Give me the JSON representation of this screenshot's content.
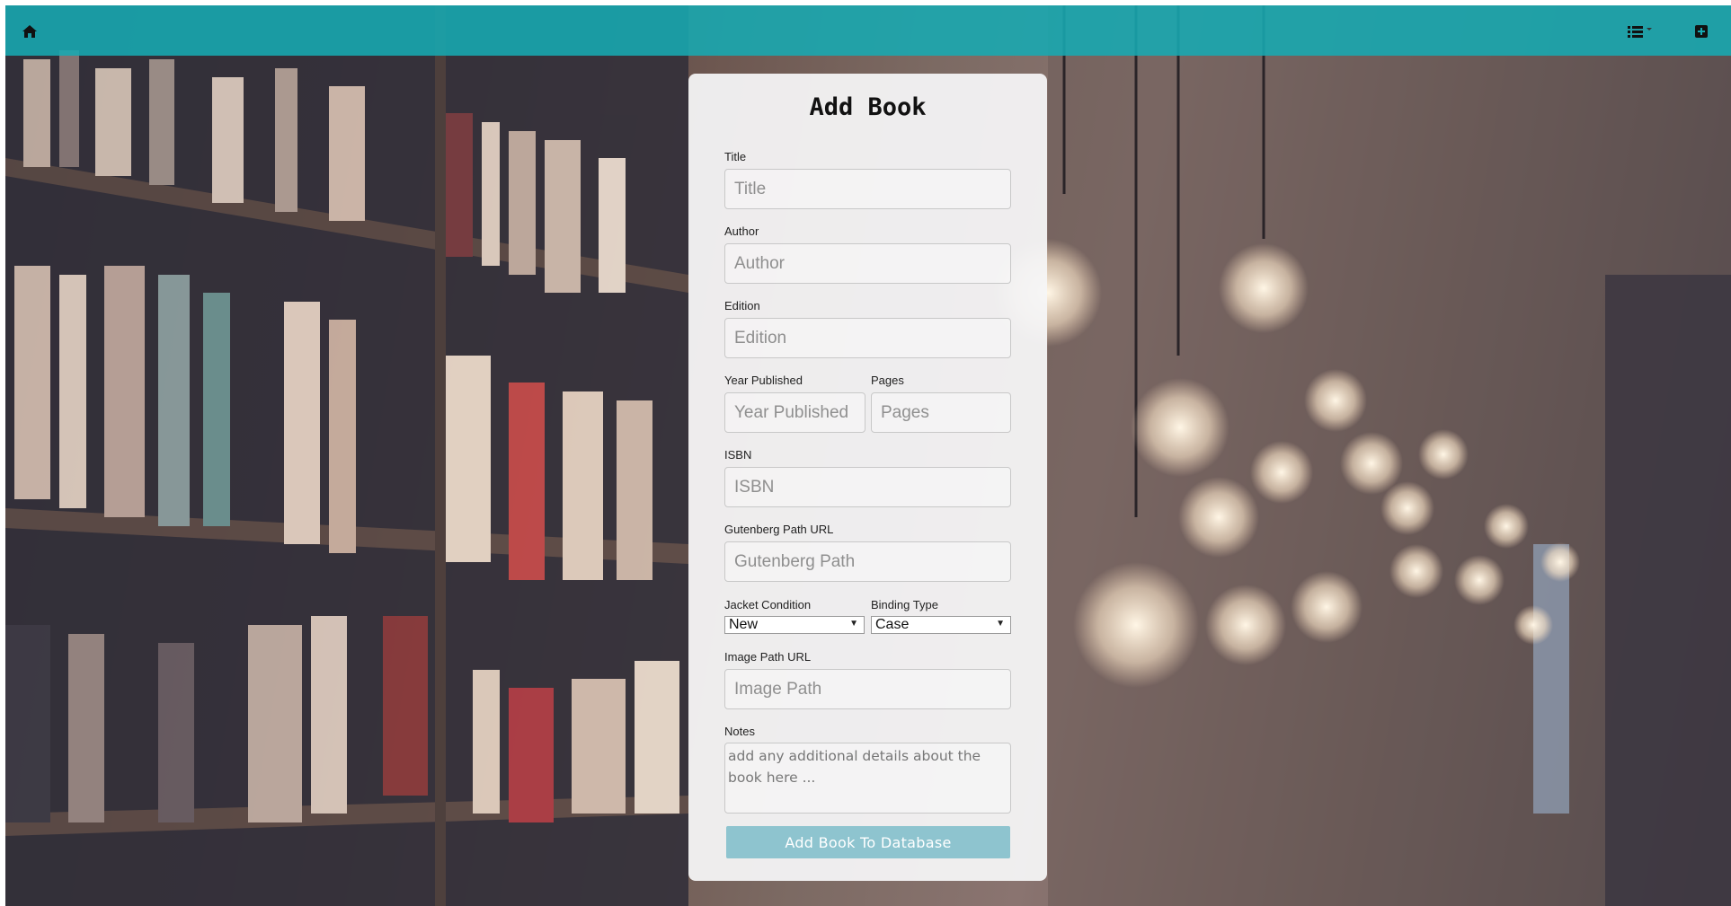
{
  "navbar": {
    "home_icon": "home-icon",
    "list_menu_icon": "list-icon",
    "add_icon": "plus-square-icon",
    "color": "#17aab2"
  },
  "form": {
    "title": "Add Book",
    "fields": {
      "title": {
        "label": "Title",
        "placeholder": "Title"
      },
      "author": {
        "label": "Author",
        "placeholder": "Author"
      },
      "edition": {
        "label": "Edition",
        "placeholder": "Edition"
      },
      "year": {
        "label": "Year Published",
        "placeholder": "Year Published"
      },
      "pages": {
        "label": "Pages",
        "placeholder": "Pages"
      },
      "isbn": {
        "label": "ISBN",
        "placeholder": "ISBN"
      },
      "gutenberg": {
        "label": "Gutenberg Path URL",
        "placeholder": "Gutenberg Path"
      },
      "jacket": {
        "label": "Jacket Condition",
        "value": "New"
      },
      "binding": {
        "label": "Binding Type",
        "value": "Case"
      },
      "image": {
        "label": "Image Path URL",
        "placeholder": "Image Path"
      },
      "notes": {
        "label": "Notes",
        "placeholder": "add any additional details about the book here ..."
      }
    },
    "submit_label": "Add Book To Database",
    "submit_color": "#8ec4cf"
  }
}
